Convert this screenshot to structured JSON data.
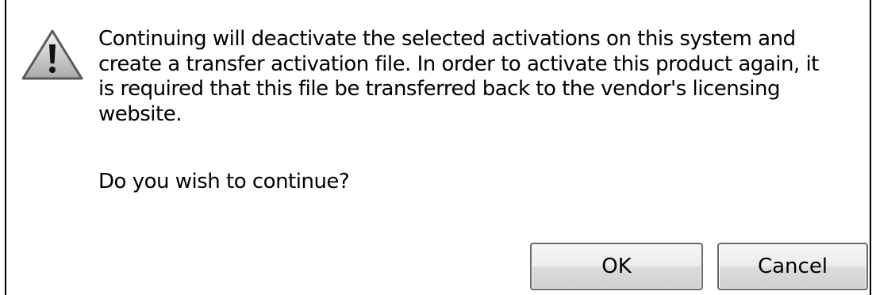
{
  "dialog": {
    "icon": "warning-icon",
    "message": "Continuing will deactivate the selected activations on this system and create a transfer activation file. In order to activate this product again, it is required that this file be transferred back to the vendor's licensing website.",
    "question": "Do you wish to continue?",
    "buttons": {
      "ok_label": "OK",
      "cancel_label": "Cancel"
    }
  }
}
